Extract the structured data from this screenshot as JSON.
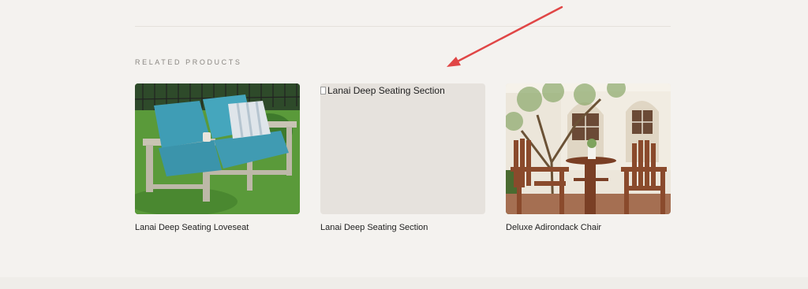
{
  "related": {
    "heading": "RELATED PRODUCTS",
    "products": [
      {
        "name": "Lanai Deep Seating Loveseat",
        "image": "loveseat-photo",
        "image_alt": ""
      },
      {
        "name": "Lanai Deep Seating Section",
        "image": "broken-image",
        "image_alt": "Lanai Deep Seating Section"
      },
      {
        "name": "Deluxe Adirondack Chair",
        "image": "adirondack-photo",
        "image_alt": ""
      }
    ]
  },
  "colors": {
    "background": "#f4f2ef",
    "heading": "#8a8782",
    "placeholder": "#e6e2dd",
    "annotation_arrow": "#e04646"
  }
}
